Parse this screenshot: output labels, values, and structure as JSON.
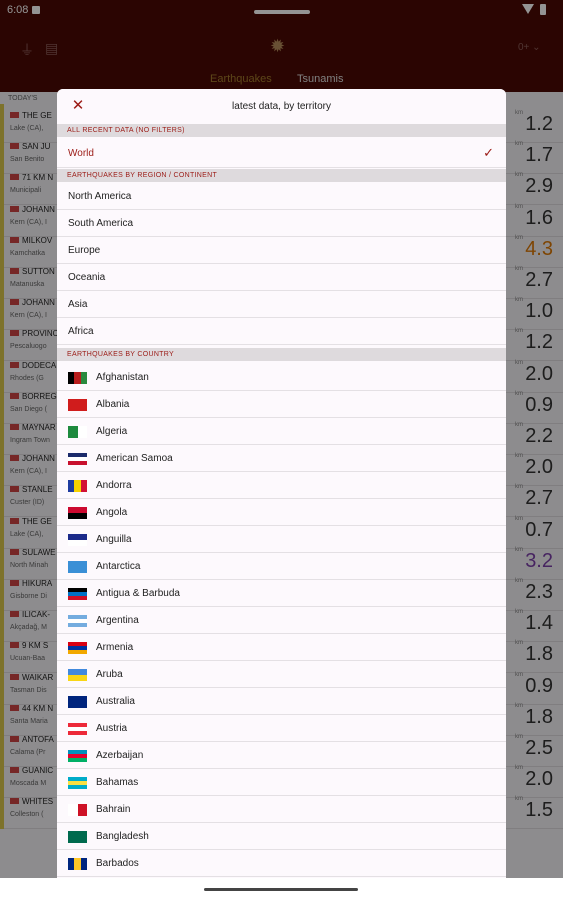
{
  "statusbar": {
    "time": "6:08"
  },
  "appbar": {
    "tab_earthquakes": "Earthquakes",
    "tab_tsunamis": "Tsunamis",
    "depth_label": "0+ ⌄",
    "today_label": "TODAY'S"
  },
  "background_list": [
    {
      "t1": "THE GE",
      "t2": "Lake (CA), ",
      "mag": "1.2"
    },
    {
      "t1": "SAN JU",
      "t2": "San Benito",
      "mag": "1.7"
    },
    {
      "t1": "71 KM N",
      "t2": "Municipali",
      "mag": "2.9"
    },
    {
      "t1": "JOHANN",
      "t2": "Kern (CA), I",
      "mag": "1.6"
    },
    {
      "t1": "MILKOV",
      "t2": "Kamchatka",
      "mag": "4.3",
      "color": "#d97706"
    },
    {
      "t1": "SUTTON",
      "t2": "Matanuska",
      "mag": "2.7"
    },
    {
      "t1": "JOHANN",
      "t2": "Kern (CA), I",
      "mag": "1.0"
    },
    {
      "t1": "PROVINC",
      "t2": "Pescaluogo",
      "mag": "1.2"
    },
    {
      "t1": "DODECA",
      "t2": "Rhodes (G",
      "mag": "2.0"
    },
    {
      "t1": "BORREG",
      "t2": "San Diego (",
      "mag": "0.9"
    },
    {
      "t1": "MAYNAR",
      "t2": "Ingram Town",
      "mag": "2.2"
    },
    {
      "t1": "JOHANN",
      "t2": "Kern (CA), I",
      "mag": "2.0"
    },
    {
      "t1": "STANLE",
      "t2": "Custer (ID)",
      "mag": "2.7"
    },
    {
      "t1": "THE GE",
      "t2": "Lake (CA), ",
      "mag": "0.7"
    },
    {
      "t1": "SULAWE",
      "t2": "North Minah",
      "mag": "3.2",
      "color": "#7b3fa8"
    },
    {
      "t1": "HIKURA",
      "t2": "Gisborne Di",
      "mag": "2.3"
    },
    {
      "t1": "ILICAK-",
      "t2": "Akçadağ, M",
      "mag": "1.4"
    },
    {
      "t1": "9 KM S",
      "t2": "Ucuan-Baa",
      "mag": "1.8"
    },
    {
      "t1": "WAIKAR",
      "t2": "Tasman Dis",
      "mag": "0.9"
    },
    {
      "t1": "44 KM N",
      "t2": "Santa Maria",
      "mag": "1.8"
    },
    {
      "t1": "ANTOFA",
      "t2": "Calama (Pr",
      "mag": "2.5"
    },
    {
      "t1": "GUANIC",
      "t2": "Moscada M",
      "mag": "2.0"
    },
    {
      "t1": "WHITES",
      "t2": "Colleston (",
      "mag": "1.5"
    }
  ],
  "dialog": {
    "close_icon": "close-icon",
    "title": "latest data, by territory",
    "section_all": "ALL RECENT DATA (NO FILTERS)",
    "world": "World",
    "section_region": "EARTHQUAKES BY REGION / CONTINENT",
    "regions": [
      "North America",
      "South America",
      "Europe",
      "Oceania",
      "Asia",
      "Africa"
    ],
    "section_country": "EARTHQUAKES BY COUNTRY",
    "countries": [
      {
        "name": "Afghanistan",
        "flag": [
          "#000",
          "#b81d1d",
          "#2a8a3e"
        ],
        "dir": "h"
      },
      {
        "name": "Albania",
        "flag": [
          "#d01c1c"
        ],
        "dir": "v"
      },
      {
        "name": "Algeria",
        "flag": [
          "#1d8a3e",
          "#fff"
        ],
        "dir": "h"
      },
      {
        "name": "American Samoa",
        "flag": [
          "#1b2a6b",
          "#fff",
          "#c8102e"
        ],
        "dir": "v"
      },
      {
        "name": "Andorra",
        "flag": [
          "#1e3ca0",
          "#f6d200",
          "#d21034"
        ],
        "dir": "h"
      },
      {
        "name": "Angola",
        "flag": [
          "#cc092f",
          "#000"
        ],
        "dir": "v"
      },
      {
        "name": "Anguilla",
        "flag": [
          "#1b2a8a",
          "#fff"
        ],
        "dir": "v"
      },
      {
        "name": "Antarctica",
        "flag": [
          "#3a8fd6"
        ],
        "dir": "v"
      },
      {
        "name": "Antigua & Barbuda",
        "flag": [
          "#000",
          "#0072c6",
          "#ce1126"
        ],
        "dir": "v"
      },
      {
        "name": "Argentina",
        "flag": [
          "#74acdf",
          "#fff",
          "#74acdf"
        ],
        "dir": "v"
      },
      {
        "name": "Armenia",
        "flag": [
          "#d90012",
          "#0033a0",
          "#f2a800"
        ],
        "dir": "v"
      },
      {
        "name": "Aruba",
        "flag": [
          "#4189dd",
          "#f9d616"
        ],
        "dir": "v"
      },
      {
        "name": "Australia",
        "flag": [
          "#00247d"
        ],
        "dir": "v"
      },
      {
        "name": "Austria",
        "flag": [
          "#ed2939",
          "#fff",
          "#ed2939"
        ],
        "dir": "v"
      },
      {
        "name": "Azerbaijan",
        "flag": [
          "#0092bc",
          "#e4002b",
          "#00af66"
        ],
        "dir": "v"
      },
      {
        "name": "Bahamas",
        "flag": [
          "#00abc9",
          "#fae042",
          "#00abc9"
        ],
        "dir": "v"
      },
      {
        "name": "Bahrain",
        "flag": [
          "#fff",
          "#ce1126"
        ],
        "dir": "h"
      },
      {
        "name": "Bangladesh",
        "flag": [
          "#006a4e"
        ],
        "dir": "v"
      },
      {
        "name": "Barbados",
        "flag": [
          "#00267f",
          "#ffc726",
          "#00267f"
        ],
        "dir": "h"
      }
    ]
  }
}
